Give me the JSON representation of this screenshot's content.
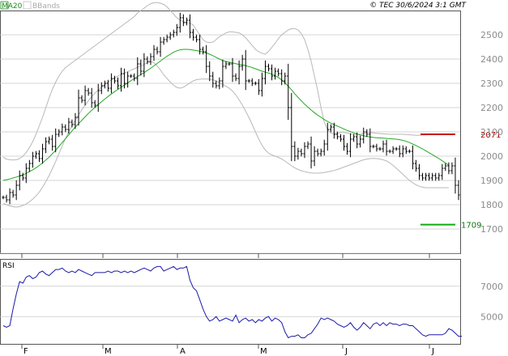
{
  "header": {
    "legend_ma": "MA20",
    "legend_bb": "BBands",
    "copyright": "© TEC 30/6/2024 3:1 GMT"
  },
  "colors": {
    "candles": "#000000",
    "ma20": "#22aa22",
    "bbands": "#b8b8b8",
    "rsi": "#1a1aaa",
    "resistance": "#cc0000",
    "support": "#11aa11",
    "grid": "#c8c8c8"
  },
  "chart_data": [
    {
      "type": "ohlc",
      "x_labels": [
        "F",
        "M",
        "A",
        "M",
        "J",
        "J"
      ],
      "ylim": [
        1600,
        2600
      ],
      "yticks": [
        1700,
        1800,
        1900,
        2000,
        2100,
        2200,
        2300,
        2400,
        2500
      ],
      "ytick_labels": [
        "1700",
        "1800",
        "1900",
        "2000",
        "2100",
        "2200",
        "2300",
        "2400",
        "2500"
      ],
      "grid": true,
      "levels": [
        {
          "label": "2071",
          "value": 2090,
          "color": "red"
        },
        {
          "label": "1709",
          "value": 1718,
          "color": "green"
        }
      ],
      "close": [
        1830,
        1820,
        1850,
        1840,
        1880,
        1920,
        1910,
        1950,
        1970,
        2000,
        2010,
        1990,
        2030,
        2060,
        2070,
        2040,
        2090,
        2100,
        2120,
        2110,
        2140,
        2130,
        2160,
        2240,
        2230,
        2270,
        2260,
        2220,
        2210,
        2270,
        2290,
        2300,
        2280,
        2320,
        2310,
        2290,
        2340,
        2300,
        2330,
        2330,
        2320,
        2380,
        2350,
        2400,
        2390,
        2410,
        2440,
        2430,
        2470,
        2480,
        2490,
        2500,
        2510,
        2530,
        2570,
        2550,
        2560,
        2510,
        2490,
        2480,
        2440,
        2430,
        2370,
        2330,
        2300,
        2290,
        2310,
        2370,
        2380,
        2380,
        2330,
        2320,
        2370,
        2400,
        2310,
        2310,
        2300,
        2300,
        2270,
        2320,
        2370,
        2360,
        2330,
        2350,
        2340,
        2310,
        2330,
        2200,
        2040,
        2000,
        2020,
        2010,
        2040,
        2050,
        1980,
        2020,
        2010,
        2020,
        2050,
        2110,
        2120,
        2090,
        2080,
        2070,
        2040,
        2020,
        2070,
        2080,
        2050,
        2070,
        2100,
        2090,
        2040,
        2040,
        2030,
        2030,
        2050,
        2020,
        2020,
        2030,
        2030,
        2010,
        2030,
        2020,
        2020,
        1970,
        1950,
        1920,
        1910,
        1920,
        1910,
        1920,
        1910,
        1920,
        1950,
        1960,
        1940,
        1960,
        1880,
        1840
      ],
      "ma20": [
        1900,
        1903,
        1906,
        1910,
        1914,
        1918,
        1923,
        1929,
        1936,
        1944,
        1952,
        1962,
        1972,
        1984,
        1996,
        2010,
        2024,
        2040,
        2056,
        2072,
        2088,
        2104,
        2120,
        2134,
        2148,
        2162,
        2176,
        2189,
        2201,
        2213,
        2224,
        2235,
        2246,
        2256,
        2266,
        2275,
        2284,
        2293,
        2302,
        2311,
        2320,
        2328,
        2336,
        2344,
        2353,
        2362,
        2372,
        2382,
        2392,
        2402,
        2412,
        2420,
        2428,
        2434,
        2438,
        2440,
        2440,
        2439,
        2437,
        2435,
        2432,
        2429,
        2425,
        2420,
        2414,
        2407,
        2400,
        2394,
        2390,
        2387,
        2384,
        2381,
        2378,
        2376,
        2373,
        2369,
        2365,
        2360,
        2355,
        2350,
        2346,
        2342,
        2338,
        2332,
        2324,
        2314,
        2302,
        2288,
        2273,
        2257,
        2242,
        2228,
        2214,
        2202,
        2190,
        2179,
        2169,
        2160,
        2151,
        2143,
        2136,
        2130,
        2124,
        2118,
        2112,
        2106,
        2101,
        2096,
        2091,
        2087,
        2084,
        2081,
        2079,
        2077,
        2076,
        2075,
        2074,
        2073,
        2072,
        2071,
        2070,
        2068,
        2065,
        2061,
        2056,
        2050,
        2044,
        2037,
        2030,
        2022,
        2014,
        2006,
        1998,
        1990,
        1981,
        1972,
        1962
      ],
      "bb_upper": [
        1995,
        1988,
        1985,
        1984,
        1985,
        1990,
        2000,
        2015,
        2035,
        2060,
        2090,
        2125,
        2160,
        2200,
        2240,
        2275,
        2305,
        2330,
        2350,
        2365,
        2375,
        2385,
        2395,
        2405,
        2415,
        2425,
        2435,
        2445,
        2455,
        2465,
        2475,
        2485,
        2495,
        2505,
        2515,
        2525,
        2535,
        2545,
        2555,
        2565,
        2575,
        2590,
        2600,
        2610,
        2620,
        2628,
        2632,
        2633,
        2630,
        2625,
        2615,
        2600,
        2585,
        2570,
        2560,
        2555,
        2550,
        2548,
        2540,
        2520,
        2500,
        2480,
        2470,
        2468,
        2470,
        2480,
        2492,
        2500,
        2508,
        2512,
        2512,
        2510,
        2508,
        2500,
        2488,
        2472,
        2456,
        2440,
        2430,
        2424,
        2420,
        2432,
        2448,
        2465,
        2485,
        2500,
        2510,
        2520,
        2525,
        2526,
        2520,
        2505,
        2480,
        2440,
        2390,
        2330,
        2270,
        2200,
        2140,
        2110,
        2095,
        2092,
        2094,
        2098,
        2098,
        2095,
        2092,
        2090,
        2090,
        2091,
        2093,
        2096,
        2097,
        2096,
        2094,
        2093,
        2092,
        2091,
        2090,
        2090,
        2090,
        2090,
        2090,
        2089,
        2088,
        2087,
        2086,
        2086,
        2087,
        2088,
        2089,
        2090,
        2090,
        2090,
        2090,
        2090,
        2090
      ],
      "bb_lower": [
        1805,
        1800,
        1795,
        1792,
        1790,
        1792,
        1797,
        1803,
        1812,
        1823,
        1836,
        1852,
        1872,
        1895,
        1920,
        1948,
        1978,
        2010,
        2042,
        2073,
        2100,
        2125,
        2148,
        2170,
        2191,
        2210,
        2228,
        2245,
        2260,
        2272,
        2284,
        2295,
        2305,
        2314,
        2322,
        2330,
        2336,
        2342,
        2348,
        2354,
        2360,
        2366,
        2372,
        2378,
        2385,
        2390,
        2385,
        2372,
        2355,
        2335,
        2320,
        2305,
        2292,
        2283,
        2280,
        2284,
        2293,
        2302,
        2310,
        2315,
        2317,
        2318,
        2318,
        2317,
        2315,
        2310,
        2303,
        2295,
        2288,
        2280,
        2268,
        2252,
        2232,
        2210,
        2185,
        2160,
        2130,
        2100,
        2070,
        2045,
        2025,
        2012,
        2005,
        2000,
        1995,
        1988,
        1980,
        1970,
        1960,
        1952,
        1945,
        1940,
        1936,
        1933,
        1931,
        1930,
        1930,
        1931,
        1933,
        1935,
        1938,
        1941,
        1945,
        1950,
        1955,
        1960,
        1965,
        1970,
        1975,
        1980,
        1985,
        1988,
        1990,
        1991,
        1990,
        1988,
        1985,
        1980,
        1972,
        1962,
        1950,
        1938,
        1925,
        1912,
        1900,
        1890,
        1882,
        1876,
        1872,
        1870,
        1870,
        1870,
        1870,
        1870,
        1870,
        1870,
        1870
      ]
    },
    {
      "type": "line",
      "name": "RSI",
      "ylim": [
        32,
        88
      ],
      "yticks": [
        50,
        70
      ],
      "ytick_labels": [
        "5000",
        "7000"
      ],
      "values": [
        44,
        43,
        44,
        55,
        65,
        73,
        72,
        76,
        77,
        75,
        76,
        79,
        80,
        78,
        77,
        79,
        81,
        81,
        82,
        80,
        79,
        80,
        79,
        81,
        80,
        79,
        78,
        77,
        79,
        79,
        79,
        79,
        80,
        79,
        80,
        80,
        79,
        80,
        79,
        80,
        79,
        80,
        81,
        82,
        81,
        80,
        82,
        83,
        83,
        80,
        81,
        82,
        83,
        81,
        82,
        82,
        83,
        74,
        69,
        67,
        61,
        55,
        50,
        47,
        48,
        50,
        47,
        48,
        49,
        48,
        47,
        51,
        46,
        48,
        49,
        47,
        48,
        46,
        48,
        47,
        49,
        50,
        47,
        49,
        48,
        46,
        40,
        36,
        37,
        37,
        38,
        36,
        36,
        38,
        39,
        42,
        45,
        49,
        48,
        49,
        48,
        47,
        45,
        44,
        43,
        44,
        46,
        43,
        41,
        43,
        46,
        44,
        42,
        45,
        46,
        44,
        46,
        44,
        46,
        45,
        45,
        44,
        45,
        45,
        44,
        44,
        42,
        40,
        38,
        37,
        38,
        38,
        38,
        38,
        38,
        39,
        42,
        41,
        39,
        37,
        37
      ]
    }
  ]
}
